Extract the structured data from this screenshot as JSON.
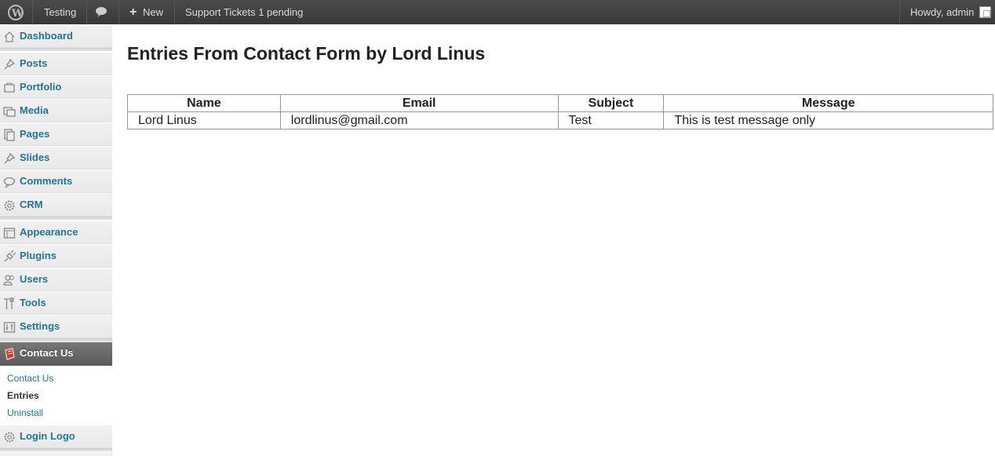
{
  "adminbar": {
    "site_name": "Testing",
    "new_label": "New",
    "support_label": "Support Tickets 1 pending",
    "greeting": "Howdy, admin",
    "icons": {
      "logo": "wordpress-logo-icon",
      "comments": "comment-bubble-icon",
      "new": "plus-icon"
    }
  },
  "sidebar": {
    "items": [
      {
        "label": "Dashboard",
        "icon": "home-icon"
      },
      {
        "label": "Posts",
        "icon": "pushpin-icon"
      },
      {
        "label": "Portfolio",
        "icon": "portfolio-icon"
      },
      {
        "label": "Media",
        "icon": "media-icon"
      },
      {
        "label": "Pages",
        "icon": "pages-icon"
      },
      {
        "label": "Slides",
        "icon": "pushpin-icon"
      },
      {
        "label": "Comments",
        "icon": "comment-icon"
      },
      {
        "label": "CRM",
        "icon": "gear-icon"
      },
      {
        "label": "Appearance",
        "icon": "appearance-icon"
      },
      {
        "label": "Plugins",
        "icon": "plug-icon"
      },
      {
        "label": "Users",
        "icon": "users-icon"
      },
      {
        "label": "Tools",
        "icon": "tools-icon"
      },
      {
        "label": "Settings",
        "icon": "settings-icon"
      },
      {
        "label": "Contact Us",
        "icon": "contact-form-icon"
      },
      {
        "label": "Login Logo",
        "icon": "gear-icon"
      }
    ],
    "submenu": [
      {
        "label": "Contact Us"
      },
      {
        "label": "Entries"
      },
      {
        "label": "Uninstall"
      }
    ]
  },
  "main": {
    "title": "Entries From Contact Form by Lord Linus",
    "table": {
      "columns": [
        "Name",
        "Email",
        "Subject",
        "Message"
      ],
      "rows": [
        [
          "Lord Linus",
          "lordlinus@gmail.com",
          "Test",
          "This is test message only"
        ]
      ]
    }
  },
  "colors": {
    "adminbar_bg": "#464646",
    "link": "#21759b",
    "active_menu_bg": "#6a6a6a"
  }
}
